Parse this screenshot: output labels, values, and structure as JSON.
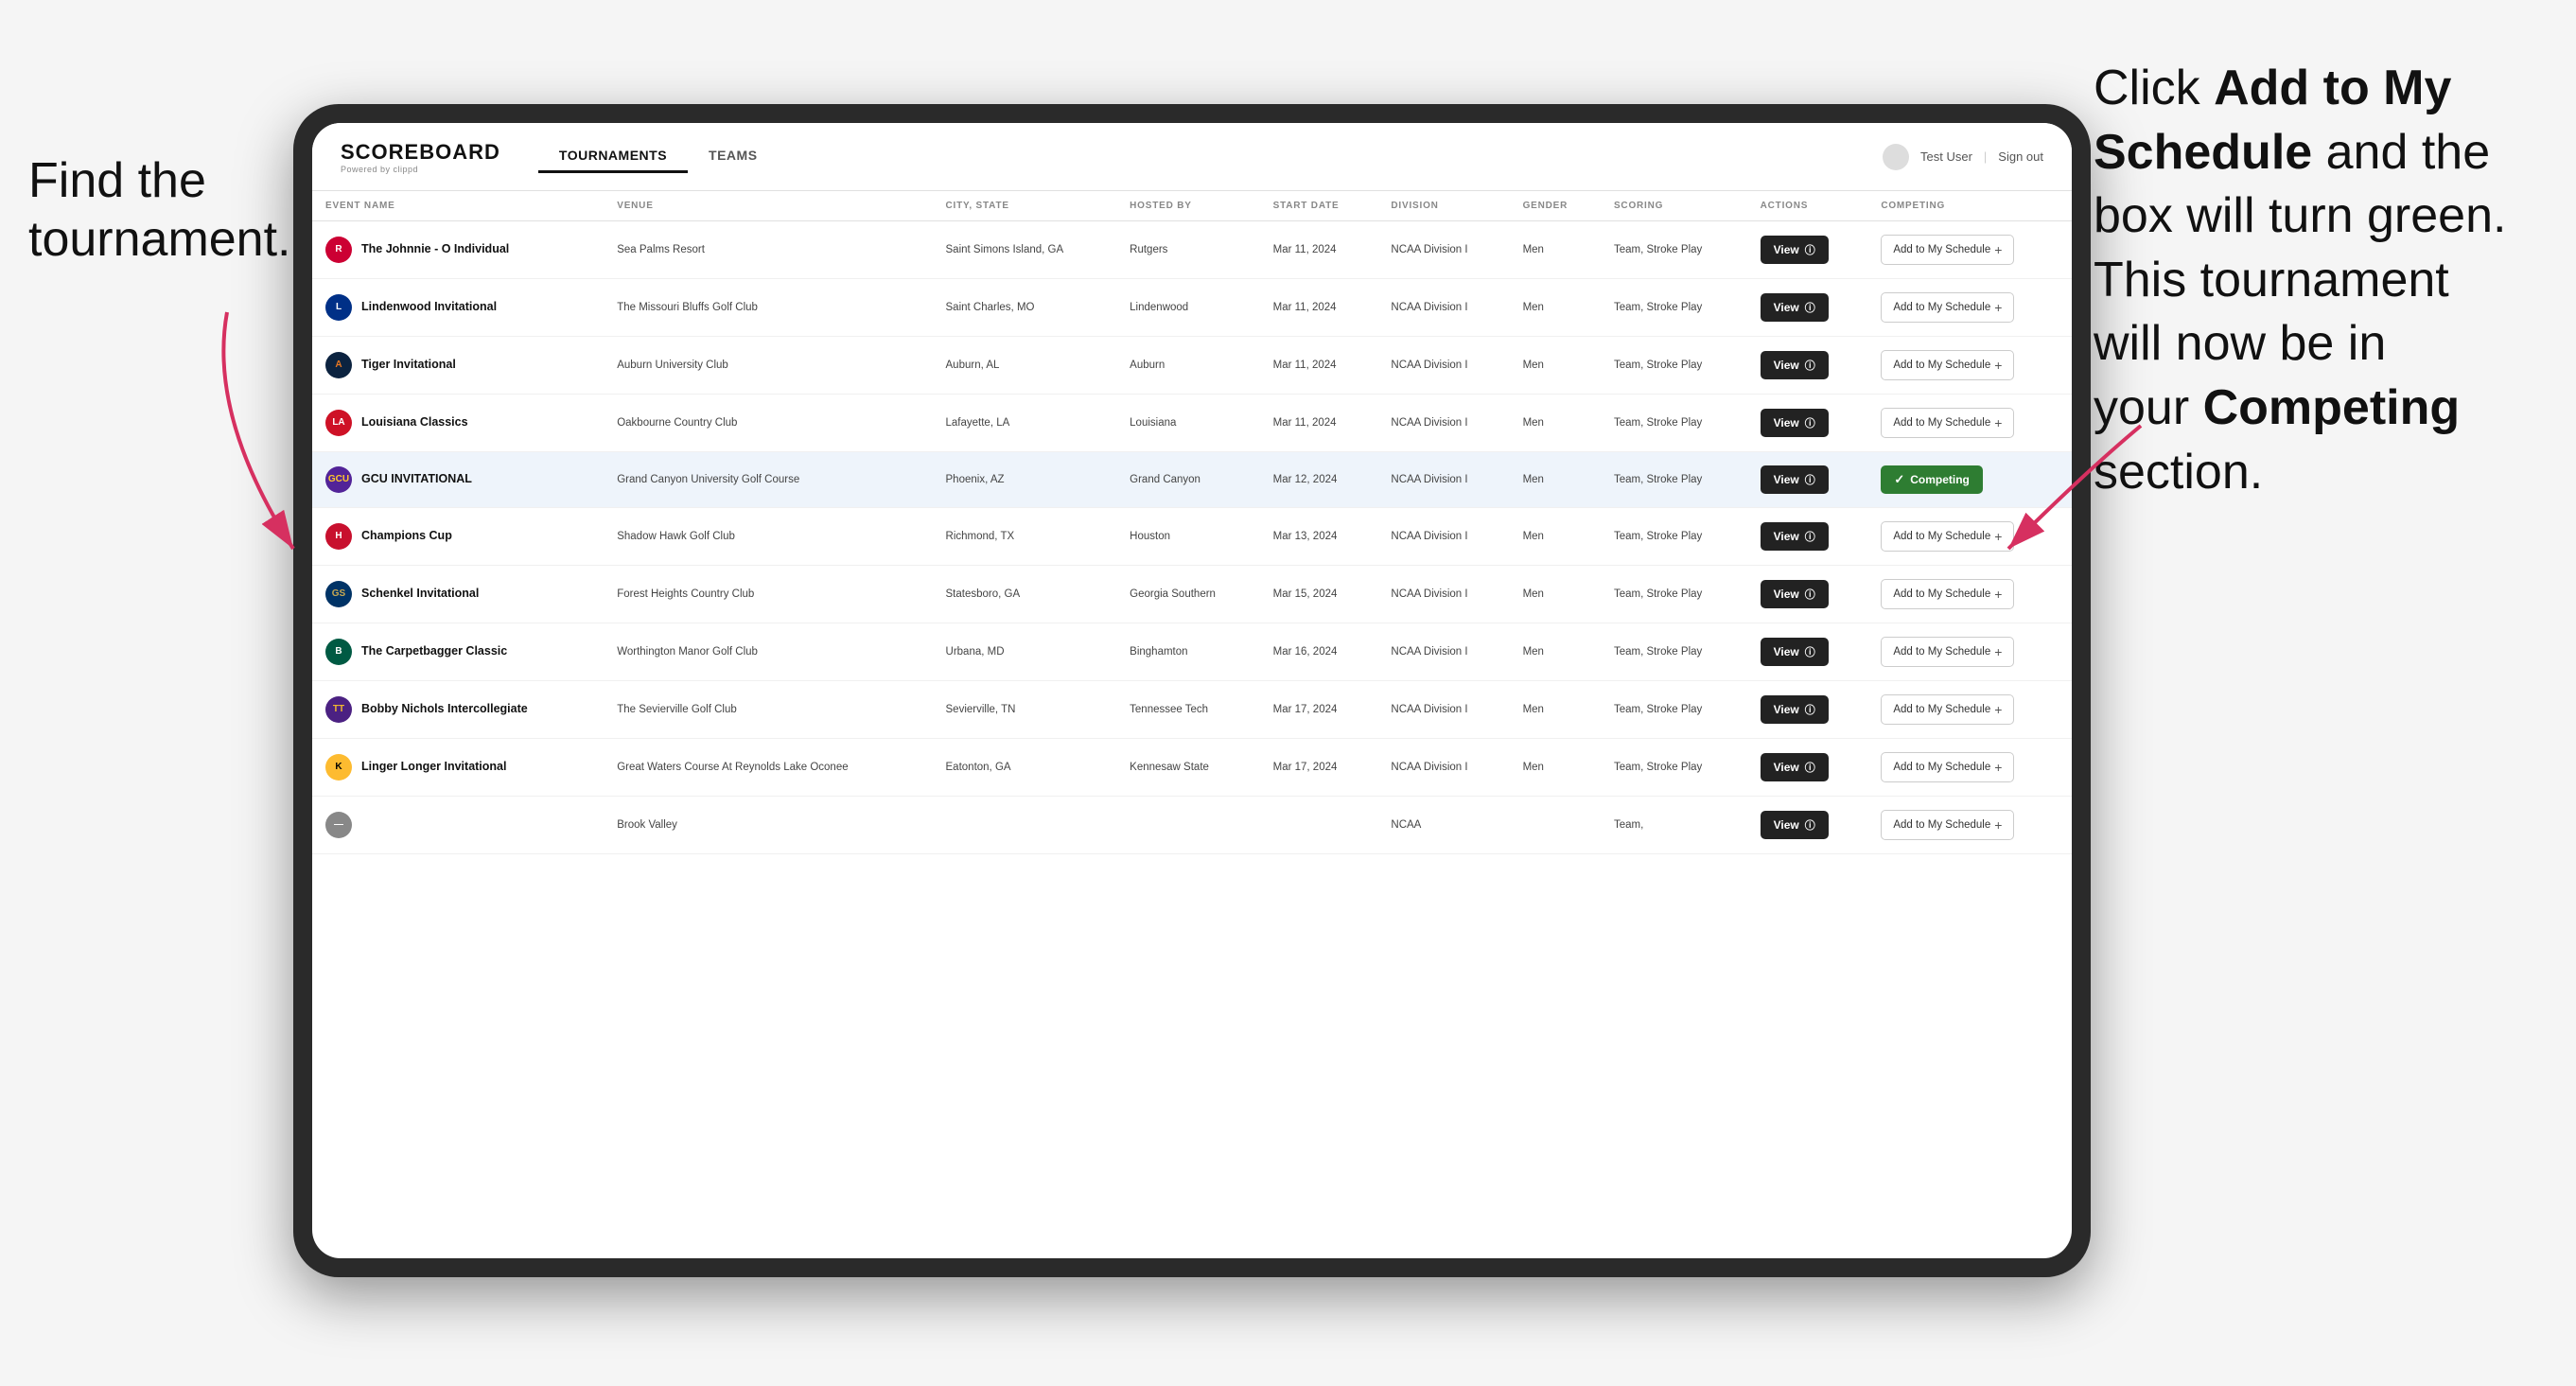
{
  "annotations": {
    "left": "Find the\ntournament.",
    "right_parts": [
      {
        "text": "Click ",
        "bold": false
      },
      {
        "text": "Add to My\nSchedule",
        "bold": true
      },
      {
        "text": " and the\nbox will turn green.\nThis tournament\nwill now be in\nyour ",
        "bold": false
      },
      {
        "text": "Competing",
        "bold": true
      },
      {
        "text": "\nsection.",
        "bold": false
      }
    ]
  },
  "header": {
    "logo": "SCOREBOARD",
    "logo_sub": "Powered by clippd",
    "nav_tabs": [
      "TOURNAMENTS",
      "TEAMS"
    ],
    "active_tab": "TOURNAMENTS",
    "user": "Test User",
    "sign_out": "Sign out"
  },
  "table": {
    "columns": [
      "EVENT NAME",
      "VENUE",
      "CITY, STATE",
      "HOSTED BY",
      "START DATE",
      "DIVISION",
      "GENDER",
      "SCORING",
      "ACTIONS",
      "COMPETING"
    ],
    "rows": [
      {
        "id": 1,
        "logo_letter": "R",
        "logo_class": "logo-rutgers",
        "event_name": "The Johnnie - O Individual",
        "venue": "Sea Palms Resort",
        "city_state": "Saint Simons Island, GA",
        "hosted_by": "Rutgers",
        "start_date": "Mar 11, 2024",
        "division": "NCAA Division I",
        "gender": "Men",
        "scoring": "Team, Stroke Play",
        "action": "View",
        "competing_status": "add",
        "competing_label": "Add to My Schedule +"
      },
      {
        "id": 2,
        "logo_letter": "L",
        "logo_class": "logo-lindenwood",
        "event_name": "Lindenwood Invitational",
        "venue": "The Missouri Bluffs Golf Club",
        "city_state": "Saint Charles, MO",
        "hosted_by": "Lindenwood",
        "start_date": "Mar 11, 2024",
        "division": "NCAA Division I",
        "gender": "Men",
        "scoring": "Team, Stroke Play",
        "action": "View",
        "competing_status": "add",
        "competing_label": "Add to My Schedule +"
      },
      {
        "id": 3,
        "logo_letter": "A",
        "logo_class": "logo-auburn",
        "event_name": "Tiger Invitational",
        "venue": "Auburn University Club",
        "city_state": "Auburn, AL",
        "hosted_by": "Auburn",
        "start_date": "Mar 11, 2024",
        "division": "NCAA Division I",
        "gender": "Men",
        "scoring": "Team, Stroke Play",
        "action": "View",
        "competing_status": "add",
        "competing_label": "Add to My Schedule +"
      },
      {
        "id": 4,
        "logo_letter": "LA",
        "logo_class": "logo-louisiana",
        "event_name": "Louisiana Classics",
        "venue": "Oakbourne Country Club",
        "city_state": "Lafayette, LA",
        "hosted_by": "Louisiana",
        "start_date": "Mar 11, 2024",
        "division": "NCAA Division I",
        "gender": "Men",
        "scoring": "Team, Stroke Play",
        "action": "View",
        "competing_status": "add",
        "competing_label": "Add to My Schedule +"
      },
      {
        "id": 5,
        "logo_letter": "GCU",
        "logo_class": "logo-gcu",
        "event_name": "GCU INVITATIONAL",
        "venue": "Grand Canyon University Golf Course",
        "city_state": "Phoenix, AZ",
        "hosted_by": "Grand Canyon",
        "start_date": "Mar 12, 2024",
        "division": "NCAA Division I",
        "gender": "Men",
        "scoring": "Team, Stroke Play",
        "action": "View",
        "competing_status": "competing",
        "competing_label": "Competing ✓",
        "highlighted": true
      },
      {
        "id": 6,
        "logo_letter": "H",
        "logo_class": "logo-houston",
        "event_name": "Champions Cup",
        "venue": "Shadow Hawk Golf Club",
        "city_state": "Richmond, TX",
        "hosted_by": "Houston",
        "start_date": "Mar 13, 2024",
        "division": "NCAA Division I",
        "gender": "Men",
        "scoring": "Team, Stroke Play",
        "action": "View",
        "competing_status": "add",
        "competing_label": "Add to My Schedule +"
      },
      {
        "id": 7,
        "logo_letter": "GS",
        "logo_class": "logo-georgia-southern",
        "event_name": "Schenkel Invitational",
        "venue": "Forest Heights Country Club",
        "city_state": "Statesboro, GA",
        "hosted_by": "Georgia Southern",
        "start_date": "Mar 15, 2024",
        "division": "NCAA Division I",
        "gender": "Men",
        "scoring": "Team, Stroke Play",
        "action": "View",
        "competing_status": "add",
        "competing_label": "Add to My Schedule +"
      },
      {
        "id": 8,
        "logo_letter": "B",
        "logo_class": "logo-binghamton",
        "event_name": "The Carpetbagger Classic",
        "venue": "Worthington Manor Golf Club",
        "city_state": "Urbana, MD",
        "hosted_by": "Binghamton",
        "start_date": "Mar 16, 2024",
        "division": "NCAA Division I",
        "gender": "Men",
        "scoring": "Team, Stroke Play",
        "action": "View",
        "competing_status": "add",
        "competing_label": "Add to My Schedule +"
      },
      {
        "id": 9,
        "logo_letter": "TT",
        "logo_class": "logo-tennessee-tech",
        "event_name": "Bobby Nichols Intercollegiate",
        "venue": "The Sevierville Golf Club",
        "city_state": "Sevierville, TN",
        "hosted_by": "Tennessee Tech",
        "start_date": "Mar 17, 2024",
        "division": "NCAA Division I",
        "gender": "Men",
        "scoring": "Team, Stroke Play",
        "action": "View",
        "competing_status": "add",
        "competing_label": "Add to My Schedule +"
      },
      {
        "id": 10,
        "logo_letter": "K",
        "logo_class": "logo-kennesaw",
        "event_name": "Linger Longer Invitational",
        "venue": "Great Waters Course At Reynolds Lake Oconee",
        "city_state": "Eatonton, GA",
        "hosted_by": "Kennesaw State",
        "start_date": "Mar 17, 2024",
        "division": "NCAA Division I",
        "gender": "Men",
        "scoring": "Team, Stroke Play",
        "action": "View",
        "competing_status": "add",
        "competing_label": "Add to My Schedule +"
      },
      {
        "id": 11,
        "logo_letter": "—",
        "logo_class": "logo-default",
        "event_name": "",
        "venue": "Brook Valley",
        "city_state": "",
        "hosted_by": "",
        "start_date": "",
        "division": "NCAA",
        "gender": "",
        "scoring": "Team,",
        "action": "View",
        "competing_status": "add",
        "competing_label": "Add to Schedule +"
      }
    ],
    "view_btn_label": "View",
    "add_btn_label": "Add to My Schedule",
    "competing_btn_label": "Competing"
  }
}
